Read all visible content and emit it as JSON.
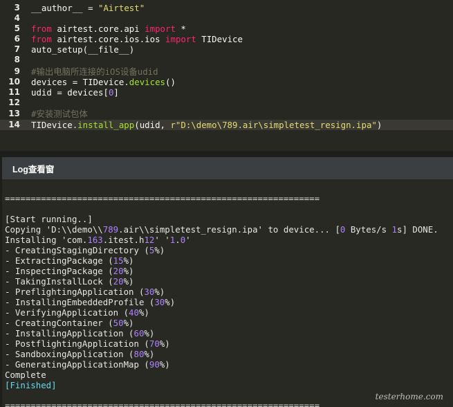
{
  "editor": {
    "lines": [
      {
        "n": "3",
        "text": "__author__ = \"Airtest\""
      },
      {
        "n": "4",
        "text": ""
      },
      {
        "n": "5",
        "text": "from airtest.core.api import *"
      },
      {
        "n": "6",
        "text": "from airtest.core.ios.ios import TIDevice"
      },
      {
        "n": "7",
        "text": "auto_setup(__file__)"
      },
      {
        "n": "8",
        "text": ""
      },
      {
        "n": "9",
        "text": "#输出电脑所连接的iOS设备udid"
      },
      {
        "n": "10",
        "text": "devices = TIDevice.devices()"
      },
      {
        "n": "11",
        "text": "udid = devices[0]"
      },
      {
        "n": "12",
        "text": ""
      },
      {
        "n": "13",
        "text": "#安装测试包体"
      },
      {
        "n": "14",
        "text": "TIDevice.install_app(udid, r\"D:\\demo\\789.air\\simpletest_resign.ipa\")"
      }
    ],
    "current_line": "14"
  },
  "log": {
    "title": "Log查看窗",
    "separator": "=============================================================",
    "lines": [
      "",
      "[Start running..]",
      "Copying 'D:\\\\demo\\\\789.air\\\\simpletest_resign.ipa' to device... [0 Bytes/s 1s] DONE.",
      "Installing 'com.163.itest.h12' '1.0'",
      "- CreatingStagingDirectory (5%)",
      "- ExtractingPackage (15%)",
      "- InspectingPackage (20%)",
      "- TakingInstallLock (20%)",
      "- PreflightingApplication (30%)",
      "- InstallingEmbeddedProfile (30%)",
      "- VerifyingApplication (40%)",
      "- CreatingContainer (50%)",
      "- InstallingApplication (60%)",
      "- PostflightingApplication (70%)",
      "- SandboxingApplication (80%)",
      "- GeneratingApplicationMap (90%)",
      "Complete",
      "[Finished]",
      ""
    ]
  },
  "watermark": "testerhome.com",
  "colors": {
    "background": "#272822",
    "keyword": "#f92672",
    "string": "#e6db74",
    "function": "#a6e22e",
    "number": "#ae81ff",
    "comment": "#75715e",
    "finished": "#66d9ef"
  }
}
